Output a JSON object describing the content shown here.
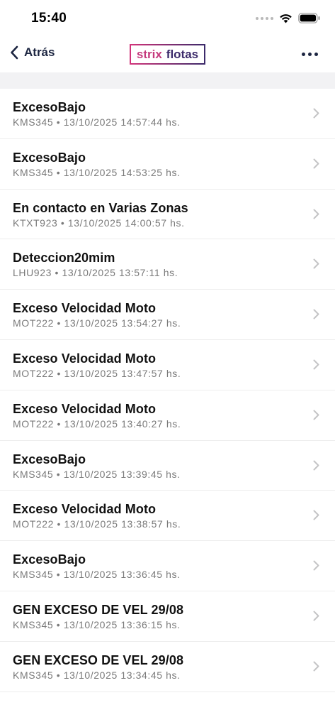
{
  "status_bar": {
    "time": "15:40"
  },
  "nav": {
    "back_label": "Atrás",
    "logo_word1": "strix",
    "logo_word2": "flotas"
  },
  "events": [
    {
      "title": "ExcesoBajo",
      "subtitle": "KMS345 • 13/10/2025 14:57:44 hs."
    },
    {
      "title": "ExcesoBajo",
      "subtitle": "KMS345 • 13/10/2025 14:53:25 hs."
    },
    {
      "title": "En contacto en Varias Zonas",
      "subtitle": "KTXT923 • 13/10/2025 14:00:57 hs."
    },
    {
      "title": "Deteccion20mim",
      "subtitle": "LHU923 • 13/10/2025 13:57:11 hs."
    },
    {
      "title": "Exceso Velocidad Moto",
      "subtitle": "MOT222 • 13/10/2025 13:54:27 hs."
    },
    {
      "title": "Exceso Velocidad Moto",
      "subtitle": "MOT222 • 13/10/2025 13:47:57 hs."
    },
    {
      "title": "Exceso Velocidad Moto",
      "subtitle": "MOT222 • 13/10/2025 13:40:27 hs."
    },
    {
      "title": "ExcesoBajo",
      "subtitle": "KMS345 • 13/10/2025 13:39:45 hs."
    },
    {
      "title": "Exceso Velocidad Moto",
      "subtitle": "MOT222 • 13/10/2025 13:38:57 hs."
    },
    {
      "title": "ExcesoBajo",
      "subtitle": "KMS345 • 13/10/2025 13:36:45 hs."
    },
    {
      "title": "GEN EXCESO DE VEL 29/08",
      "subtitle": "KMS345 • 13/10/2025 13:36:15 hs."
    },
    {
      "title": "GEN EXCESO DE VEL 29/08",
      "subtitle": "KMS345 • 13/10/2025 13:34:45 hs."
    }
  ],
  "colors": {
    "brand_pink": "#c53a7d",
    "brand_purple": "#3b2a6a",
    "nav_text": "#1c2541"
  },
  "icons": {
    "back": "chevron-left-icon",
    "more": "ellipsis-icon",
    "row": "chevron-right-icon"
  }
}
